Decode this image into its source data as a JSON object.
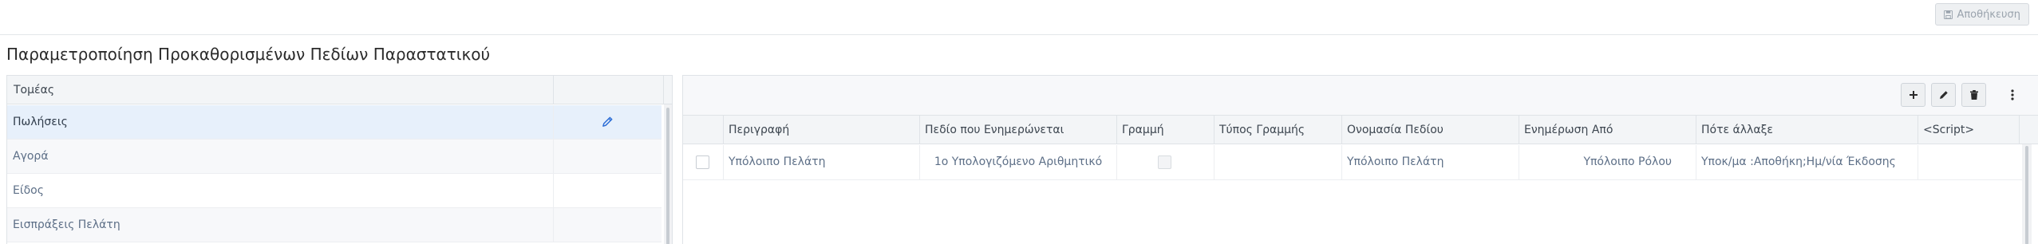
{
  "header": {
    "save_label": "Αποθήκευση",
    "page_title": "Παραμετροποίηση Προκαθορισμένων Πεδίων Παραστατικού"
  },
  "sectors": {
    "column_header": "Τομέας",
    "items": [
      {
        "label": "Πωλήσεις",
        "selected": true
      },
      {
        "label": "Αγορά",
        "selected": false
      },
      {
        "label": "Είδος",
        "selected": false
      },
      {
        "label": "Εισπράξεις Πελάτη",
        "selected": false
      }
    ]
  },
  "fields_grid": {
    "toolbar": {
      "add_icon": "plus-icon",
      "edit_icon": "pencil-icon",
      "delete_icon": "trash-icon",
      "more_icon": "vertical-ellipsis-icon"
    },
    "columns": [
      "Περιγραφή",
      "Πεδίο που Ενημερώνεται",
      "Γραμμή",
      "Τύπος Γραμμής",
      "Ονομασία Πεδίου",
      "Ενημέρωση Από",
      "Πότε άλλαξε",
      "<Script>"
    ],
    "rows": [
      {
        "description": "Υπόλοιπο Πελάτη",
        "updated_field": "1ο Υπολογιζόμενο Αριθμητικό",
        "line": false,
        "line_type": "",
        "field_name": "Υπόλοιπο Πελάτη",
        "update_from": "Υπόλοιπο Ρόλου",
        "when_changed": "Υποκ/μα :Αποθήκη;Ημ/νία Έκδοσης",
        "script": ""
      }
    ]
  },
  "colors": {
    "selected_row": "#e7f0fb",
    "header_bg": "#f3f5f7",
    "link_text": "#5d6f87",
    "edit_icon": "#2f6fd6"
  }
}
